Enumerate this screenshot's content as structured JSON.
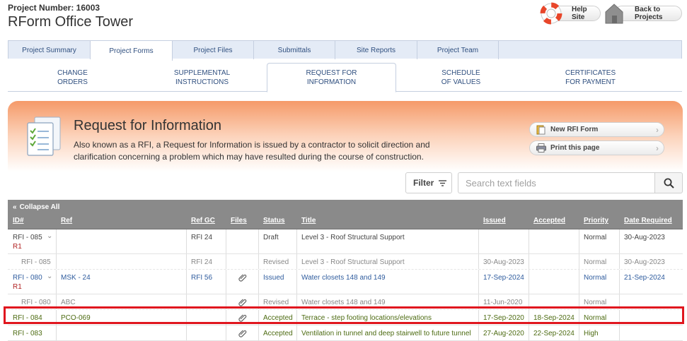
{
  "project": {
    "number_label": "Project Number: 16003",
    "title": "RForm Office Tower"
  },
  "header_buttons": {
    "help": "Help Site",
    "back": "Back to Projects"
  },
  "main_tabs": [
    "Project Summary",
    "Project Forms",
    "Project Files",
    "Submittals",
    "Site Reports",
    "Project Team"
  ],
  "main_tabs_active": "Project Forms",
  "sub_tabs": [
    {
      "line1": "CHANGE",
      "line2": "ORDERS"
    },
    {
      "line1": "SUPPLEMENTAL",
      "line2": "INSTRUCTIONS"
    },
    {
      "line1": "REQUEST FOR",
      "line2": "INFORMATION"
    },
    {
      "line1": "SCHEDULE",
      "line2": "OF VALUES"
    },
    {
      "line1": "CERTIFICATES",
      "line2": "FOR PAYMENT"
    }
  ],
  "banner": {
    "title": "Request for Information",
    "description": "Also known as a RFI, a Request for Information is issued by a contractor to solicit direction and clarification concerning a problem which may have resulted during the course of construction.",
    "new_button": "New RFI Form",
    "print_button": "Print this page"
  },
  "toolbar": {
    "filter_label": "Filter",
    "search_placeholder": "Search text fields"
  },
  "table": {
    "collapse_label": "Collapse All",
    "columns": [
      "ID#",
      "Ref",
      "Ref GC",
      "Files",
      "Status",
      "Title",
      "Issued",
      "Accepted",
      "Priority",
      "Date Required"
    ],
    "rows": [
      {
        "id": "RFI - 085",
        "rev": "R1",
        "ref": "",
        "ref_gc": "RFI 24",
        "file": false,
        "status": "Draft",
        "title": "Level 3 - Roof Structural Support",
        "issued": "",
        "accepted": "",
        "priority": "Normal",
        "required": "30-Aug-2023"
      },
      {
        "id": "RFI - 085",
        "rev": "",
        "ref": "",
        "ref_gc": "RFI 24",
        "file": false,
        "status": "Revised",
        "title": "Level 3 - Roof Structural Support",
        "issued": "30-Aug-2023",
        "accepted": "",
        "priority": "Normal",
        "required": "30-Aug-2023"
      },
      {
        "id": "RFI - 080",
        "rev": "R1",
        "ref": "MSK - 24",
        "ref_gc": "RFI 56",
        "file": true,
        "status": "Issued",
        "title": "Water closets 148 and 149",
        "issued": "17-Sep-2024",
        "accepted": "",
        "priority": "Normal",
        "required": "21-Sep-2024"
      },
      {
        "id": "RFI - 080",
        "rev": "",
        "ref": "ABC",
        "ref_gc": "",
        "file": true,
        "status": "Revised",
        "title": "Water closets 148 and 149",
        "issued": "11-Jun-2020",
        "accepted": "",
        "priority": "Normal",
        "required": ""
      },
      {
        "id": "RFI - 084",
        "rev": "",
        "ref": "PCO-069",
        "ref_gc": "",
        "file": true,
        "status": "Accepted",
        "title": "Terrace - step footing locations/elevations",
        "issued": "17-Sep-2020",
        "accepted": "18-Sep-2024",
        "priority": "Normal",
        "required": ""
      },
      {
        "id": "RFI - 083",
        "rev": "",
        "ref": "",
        "ref_gc": "",
        "file": true,
        "status": "Accepted",
        "title": "Ventilation in tunnel and deep stairwell to future tunnel",
        "issued": "27-Aug-2020",
        "accepted": "22-Sep-2024",
        "priority": "High",
        "required": ""
      }
    ]
  },
  "colors": {
    "accent_blue": "#2f5c9e",
    "accepted_green": "#4d6b12",
    "highlight_red": "#e0161e",
    "banner_orange": "#f59a69"
  }
}
